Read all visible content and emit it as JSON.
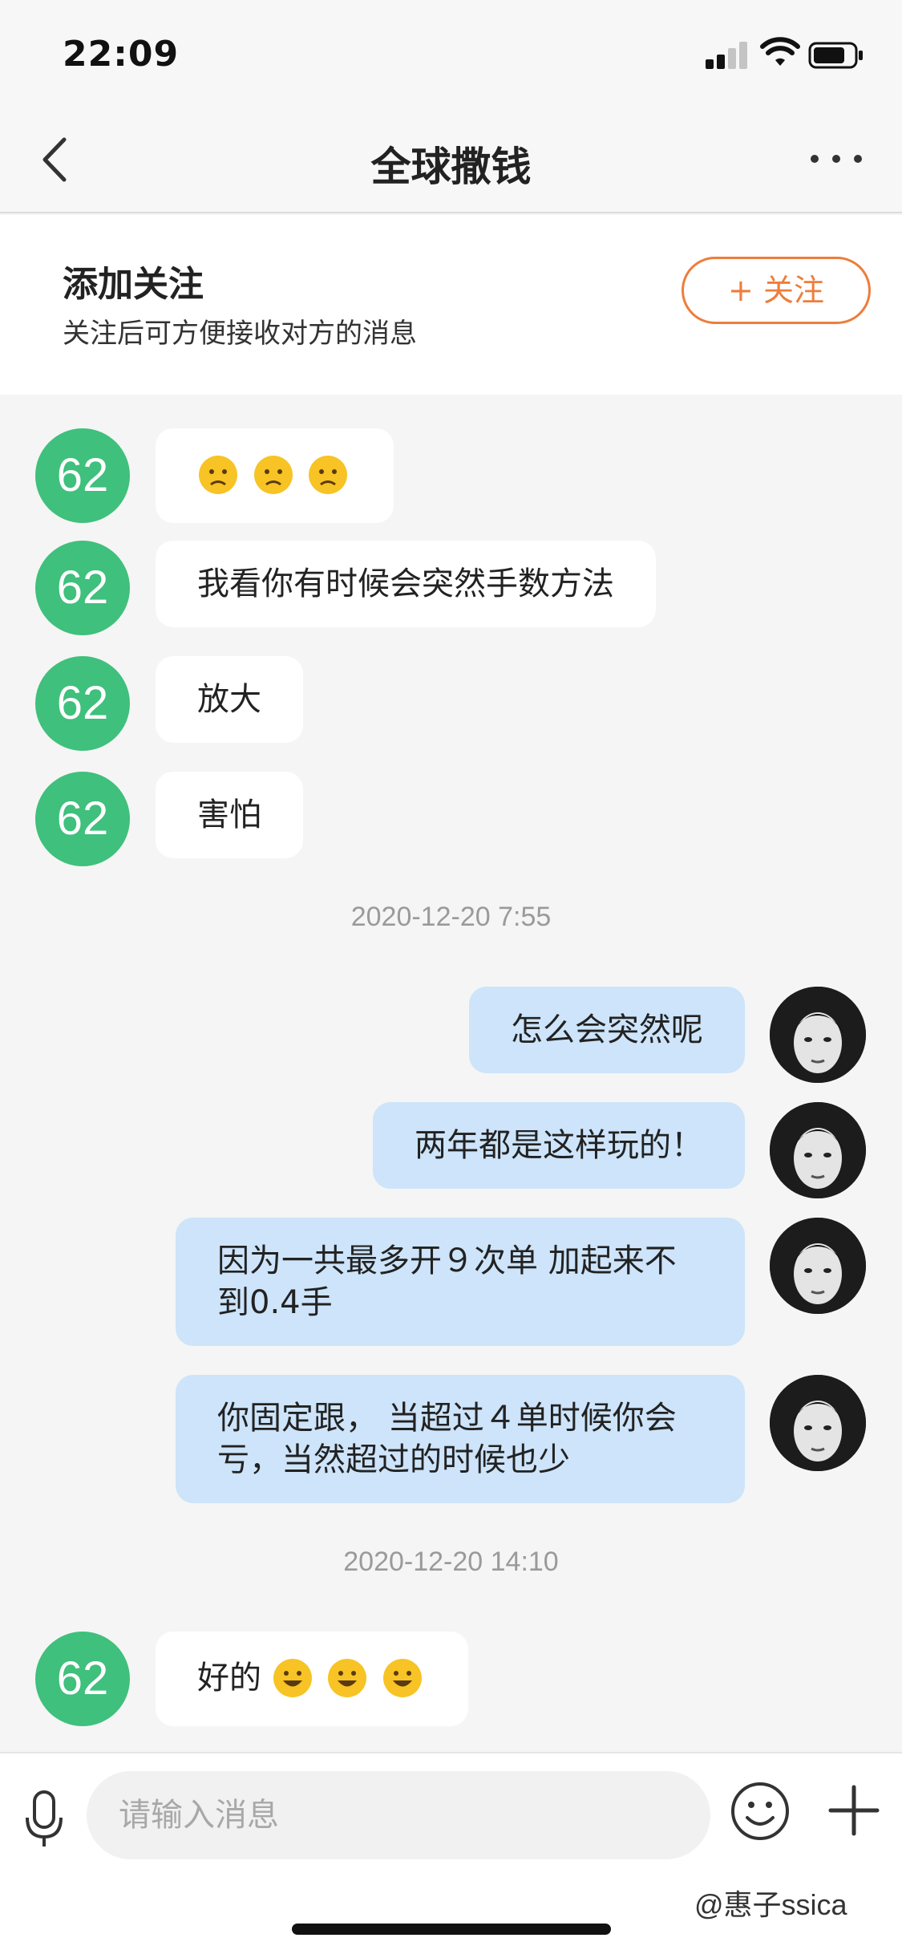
{
  "status_bar": {
    "time": "22:09"
  },
  "nav": {
    "title": "全球撒钱",
    "back_icon": "chevron-left-icon",
    "more_icon": "more-horizontal-icon"
  },
  "follow_banner": {
    "title": "添加关注",
    "subtitle": "关注后可方便接收对方的消息",
    "button_label": "+ 关注",
    "accent_color": "#ee7d3b"
  },
  "contact": {
    "avatar_label": "62",
    "avatar_color": "#3fc07c"
  },
  "messages": [
    {
      "from": "contact",
      "text": "",
      "emoji": [
        "frowning-face",
        "frowning-face",
        "frowning-face"
      ]
    },
    {
      "from": "contact",
      "text": "我看你有时候会突然手数方法"
    },
    {
      "from": "contact",
      "text": "放大"
    },
    {
      "from": "contact",
      "text": "害怕"
    },
    {
      "type": "timestamp",
      "text": "2020-12-20 7:55"
    },
    {
      "from": "me",
      "text": "怎么会突然呢"
    },
    {
      "from": "me",
      "text": "两年都是这样玩的！"
    },
    {
      "from": "me",
      "text": "因为一共最多开９次单 加起来不到0.4手"
    },
    {
      "from": "me",
      "text": "你固定跟， 当超过４单时候你会亏，当然超过的时候也少"
    },
    {
      "type": "timestamp",
      "text": "2020-12-20 14:10"
    },
    {
      "from": "contact",
      "text": "好的",
      "emoji": [
        "grinning-face",
        "grinning-face",
        "grinning-face"
      ]
    }
  ],
  "input_bar": {
    "placeholder": "请输入消息",
    "mic_icon": "microphone-icon",
    "emoji_icon": "smiley-icon",
    "plus_icon": "plus-icon"
  },
  "watermark": "@惠子ssica",
  "colors": {
    "incoming_bubble": "#ffffff",
    "outgoing_bubble": "#cde4fa",
    "chat_background": "#f5f5f5"
  }
}
